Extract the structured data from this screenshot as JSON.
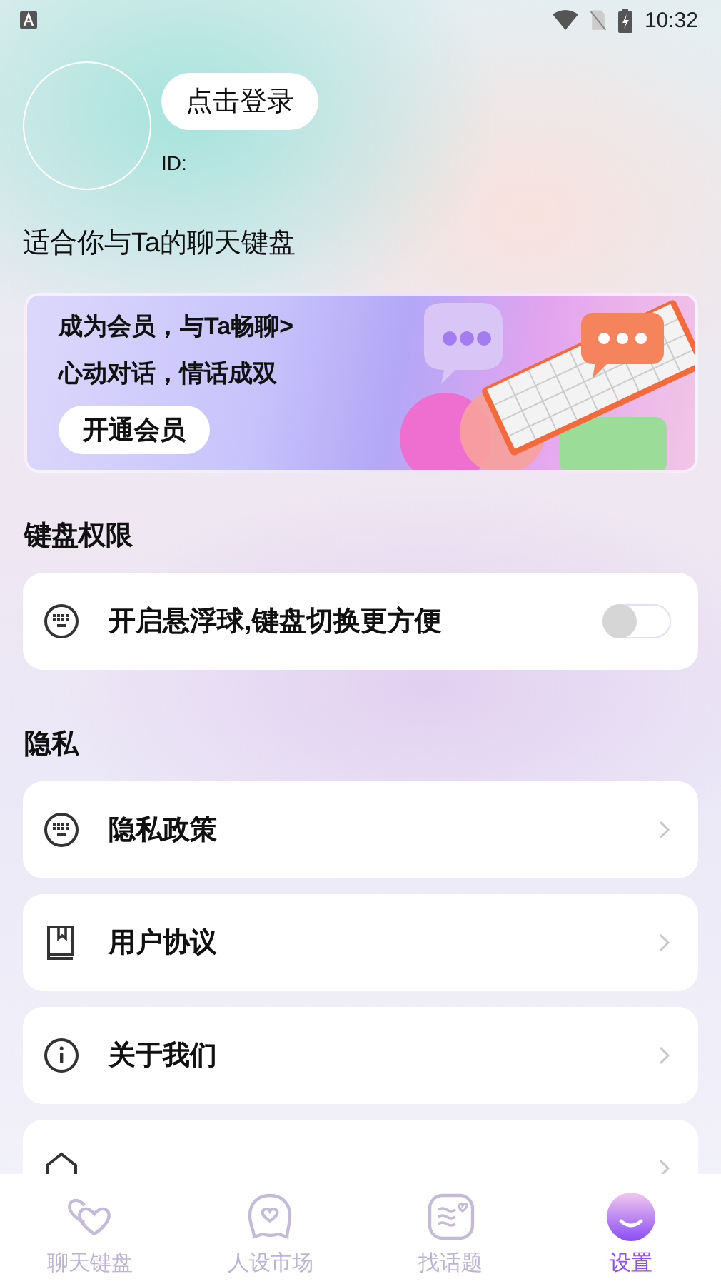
{
  "status_bar": {
    "time": "10:32"
  },
  "profile": {
    "login_button": "点击登录",
    "id_label": "ID:",
    "tagline": "适合你与Ta的聊天键盘"
  },
  "banner": {
    "lines": [
      "成为会员，与Ta畅聊>",
      "心动对话，情话成双"
    ],
    "button": "开通会员"
  },
  "sections": [
    {
      "title": "键盘权限",
      "items": [
        {
          "kind": "toggle",
          "label": "开启悬浮球,键盘切换更方便",
          "on": false
        }
      ]
    },
    {
      "title": "隐私",
      "items": [
        {
          "kind": "link",
          "label": "隐私政策"
        },
        {
          "kind": "link",
          "label": "用户协议"
        },
        {
          "kind": "link",
          "label": "关于我们"
        },
        {
          "kind": "link"
        }
      ]
    }
  ],
  "tabs": [
    {
      "label": "聊天键盘",
      "selected": false
    },
    {
      "label": "人设市场",
      "selected": false
    },
    {
      "label": "找话题",
      "selected": false
    },
    {
      "label": "设置",
      "selected": true
    }
  ]
}
